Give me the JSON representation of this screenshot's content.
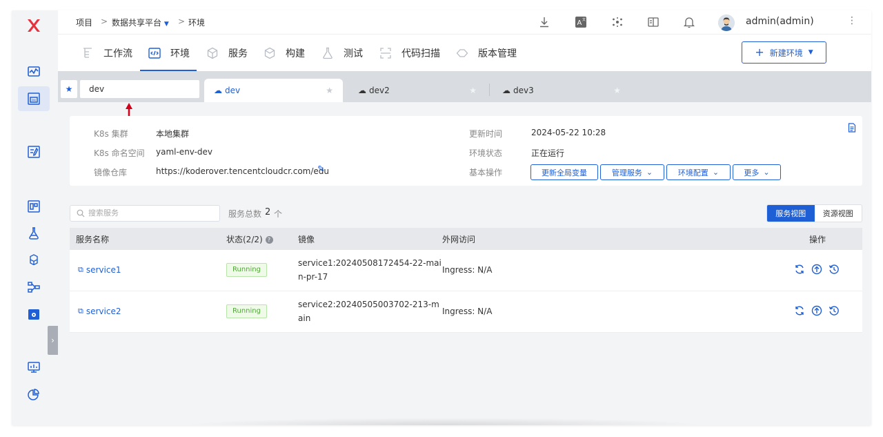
{
  "breadcrumb": {
    "root": "项目",
    "project": "数据共享平台",
    "current": "环境"
  },
  "user": {
    "name": "admin(admin)"
  },
  "nav": {
    "items": [
      {
        "label": "工作流",
        "icon": "workflow-icon"
      },
      {
        "label": "环境",
        "icon": "code-icon"
      },
      {
        "label": "服务",
        "icon": "cube-icon"
      },
      {
        "label": "构建",
        "icon": "box-icon"
      },
      {
        "label": "测试",
        "icon": "flask-icon"
      },
      {
        "label": "代码扫描",
        "icon": "scan-icon"
      },
      {
        "label": "版本管理",
        "icon": "diamond-icon"
      }
    ],
    "new_env": "新建环境"
  },
  "env_search": {
    "value": "dev"
  },
  "env_tabs": [
    {
      "label": "dev"
    },
    {
      "label": "dev2"
    },
    {
      "label": "dev3"
    }
  ],
  "info": {
    "cluster_label": "K8s 集群",
    "cluster_value": "本地集群",
    "namespace_label": "K8s 命名空间",
    "namespace_value": "yaml-env-dev",
    "registry_label": "镜像仓库",
    "registry_value": "https://koderover.tencentcloudcr.com/edu",
    "updated_label": "更新时间",
    "updated_value": "2024-05-22 10:28",
    "status_label": "环境状态",
    "status_value": "正在运行",
    "ops_label": "基本操作",
    "ops": [
      "更新全局变量",
      "管理服务",
      "环境配置",
      "更多"
    ]
  },
  "services": {
    "search_placeholder": "搜索服务",
    "count_label": "服务总数",
    "count": "2",
    "count_unit": "个",
    "view_service": "服务视图",
    "view_resource": "资源视图",
    "headers": {
      "name": "服务名称",
      "status": "状态(2/2)",
      "image": "镜像",
      "access": "外网访问",
      "actions": "操作"
    },
    "rows": [
      {
        "name": "service1",
        "status": "Running",
        "image_line1": "service1:20240508172454-22-mai",
        "image_line2": "n-pr-17",
        "access": "Ingress: N/A"
      },
      {
        "name": "service2",
        "status": "Running",
        "image_line1": "service2:20240505003702-213-m",
        "image_line2": "ain",
        "access": "Ingress: N/A"
      }
    ]
  },
  "colors": {
    "accent": "#1f5fd6",
    "running_text": "#52a63a",
    "logo": "#e5323e",
    "annotation_arrow": "#d0021b"
  }
}
